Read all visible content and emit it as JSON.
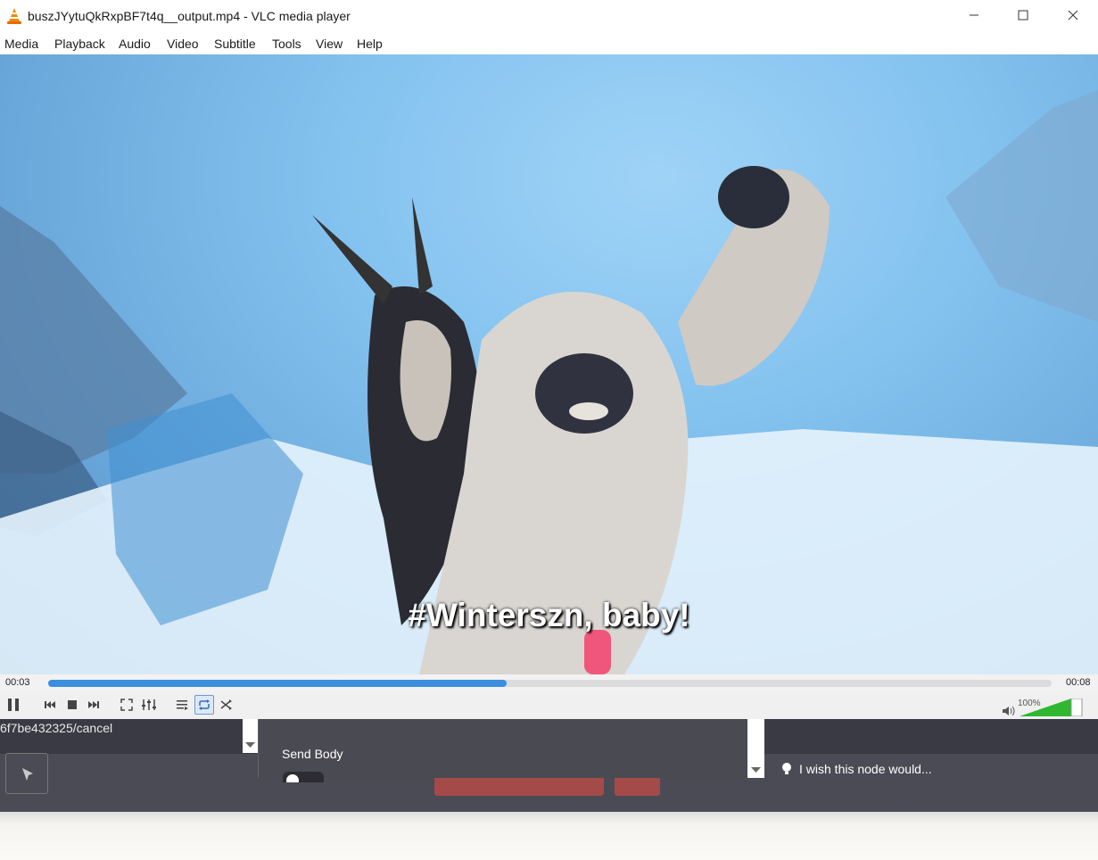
{
  "window": {
    "title": "buszJYytuQkRxpBF7t4q__output.mp4 - VLC media player",
    "controls": [
      "minimize-icon",
      "maximize-icon",
      "close-icon"
    ]
  },
  "menu": [
    {
      "label": "Media"
    },
    {
      "label": "Playback"
    },
    {
      "label": "Audio"
    },
    {
      "label": "Video"
    },
    {
      "label": "Subtitle"
    },
    {
      "label": "Tools"
    },
    {
      "label": "View"
    },
    {
      "label": "Help"
    }
  ],
  "video": {
    "subtitle": "#Winterszn, baby!"
  },
  "playback": {
    "current_time": "00:03",
    "total_time": "00:08",
    "progress": 0.457,
    "volume_label": "100%",
    "volume_level": 1.0,
    "loop_active": true
  },
  "colors": {
    "accent": "#3b8ede",
    "volume_green": "#2fb82f",
    "background_app": "#4b4b55"
  },
  "background_app": {
    "url_fragment": "6f7be432325/cancel",
    "panel_label": "Send Body",
    "wish_text": "I wish this node would..."
  }
}
